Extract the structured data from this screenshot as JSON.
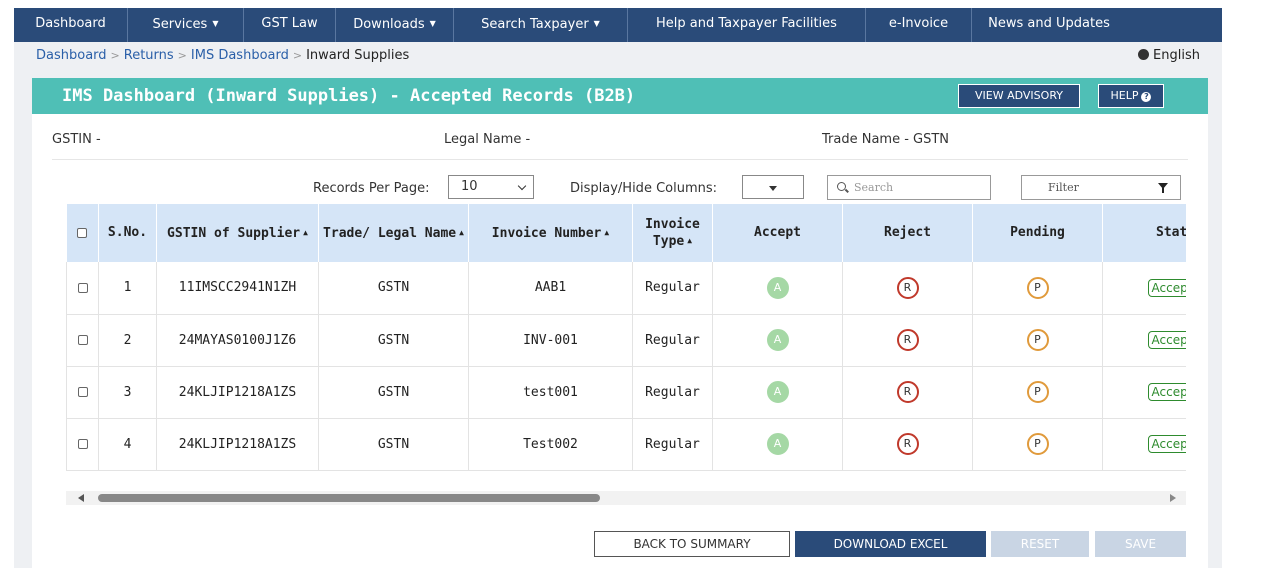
{
  "nav": {
    "items": [
      {
        "label": "Dashboard",
        "dropdown": false
      },
      {
        "label": "Services",
        "dropdown": true
      },
      {
        "label": "GST Law",
        "dropdown": false
      },
      {
        "label": "Downloads",
        "dropdown": true
      },
      {
        "label": "Search Taxpayer",
        "dropdown": true
      },
      {
        "label": "Help and Taxpayer Facilities",
        "dropdown": false
      },
      {
        "label": "e-Invoice",
        "dropdown": false
      },
      {
        "label": "News and Updates",
        "dropdown": false
      }
    ]
  },
  "breadcrumb": {
    "items": [
      "Dashboard",
      "Returns",
      "IMS Dashboard"
    ],
    "current": "Inward Supplies",
    "separator": ">"
  },
  "language": "English",
  "panel": {
    "title": "IMS Dashboard (Inward Supplies) - Accepted Records (B2B)",
    "view_advisory": "VIEW ADVISORY",
    "help": "HELP",
    "help_glyph": "?"
  },
  "info": {
    "gstin": "GSTIN -",
    "legal_name": "Legal Name -",
    "trade_name": "Trade Name - GSTN"
  },
  "controls": {
    "records_per_page_label": "Records Per Page:",
    "records_per_page_value": "10",
    "display_hide_label": "Display/Hide Columns:",
    "search_placeholder": "Search",
    "filter_placeholder": "Filter"
  },
  "table": {
    "headers": [
      {
        "label": "",
        "sortable": false
      },
      {
        "label": "S.No.",
        "sortable": false
      },
      {
        "label": "GSTIN of Supplier",
        "sortable": true
      },
      {
        "label": "Trade/ Legal Name",
        "sortable": true
      },
      {
        "label": "Invoice Number",
        "sortable": true
      },
      {
        "label": "Invoice Type",
        "sortable": true
      },
      {
        "label": "Accept",
        "sortable": false
      },
      {
        "label": "Reject",
        "sortable": false
      },
      {
        "label": "Pending",
        "sortable": false
      },
      {
        "label": "Status",
        "sortable": false
      }
    ],
    "sort_glyph": "▲",
    "action_letters": {
      "accept": "A",
      "reject": "R",
      "pending": "P"
    },
    "rows": [
      {
        "sno": "1",
        "gstin": "11IMSCC2941N1ZH",
        "name": "GSTN",
        "invoice": "AAB1",
        "type": "Regular",
        "status": "Accepted"
      },
      {
        "sno": "2",
        "gstin": "24MAYAS0100J1Z6",
        "name": "GSTN",
        "invoice": "INV-001",
        "type": "Regular",
        "status": "Accepted"
      },
      {
        "sno": "3",
        "gstin": "24KLJIP1218A1ZS",
        "name": "GSTN",
        "invoice": "test001",
        "type": "Regular",
        "status": "Accepted"
      },
      {
        "sno": "4",
        "gstin": "24KLJIP1218A1ZS",
        "name": "GSTN",
        "invoice": "Test002",
        "type": "Regular",
        "status": "Accepted"
      }
    ]
  },
  "buttons": {
    "back": "BACK TO SUMMARY",
    "download": "DOWNLOAD EXCEL",
    "reset": "RESET",
    "save": "SAVE"
  },
  "colors": {
    "nav_bg": "#2a4b79",
    "panel_header": "#4fbfb6",
    "table_header": "#d5e5f7",
    "accept": "#a5d8a5",
    "reject": "#c0392b",
    "pending": "#e09a3b",
    "status_green": "#2e8b2e"
  }
}
